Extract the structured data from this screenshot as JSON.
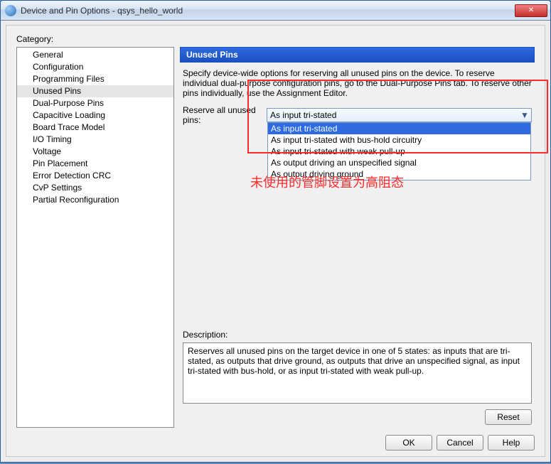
{
  "titlebar": {
    "title": "Device and Pin Options - qsys_hello_world"
  },
  "category_label": "Category:",
  "categories": [
    "General",
    "Configuration",
    "Programming Files",
    "Unused Pins",
    "Dual-Purpose Pins",
    "Capacitive Loading",
    "Board Trace Model",
    "I/O Timing",
    "Voltage",
    "Pin Placement",
    "Error Detection CRC",
    "CvP Settings",
    "Partial Reconfiguration"
  ],
  "selected_category_index": 3,
  "panel_header": "Unused Pins",
  "instructions": "Specify device-wide options for reserving all unused pins on the device. To reserve individual dual-purpose configuration pins, go to the Dual-Purpose Pins tab. To reserve other pins individually, use the Assignment Editor.",
  "reserve_label": "Reserve all unused pins:",
  "combo_value": "As input tri-stated",
  "dropdown_options": [
    "As input tri-stated",
    "As input tri-stated with bus-hold circuitry",
    "As input tri-stated with weak pull-up",
    "As output driving an unspecified signal",
    "As output driving ground"
  ],
  "dropdown_highlight_index": 0,
  "description_label": "Description:",
  "description_text": "Reserves all unused pins on the target device in one of 5 states: as inputs that are tri-stated, as outputs that drive ground, as outputs that drive an unspecified signal, as input tri-stated with bus-hold, or as input tri-stated with weak pull-up.",
  "buttons": {
    "reset": "Reset",
    "ok": "OK",
    "cancel": "Cancel",
    "help": "Help"
  },
  "annotation_text": "未使用的管脚设置为高阻态"
}
